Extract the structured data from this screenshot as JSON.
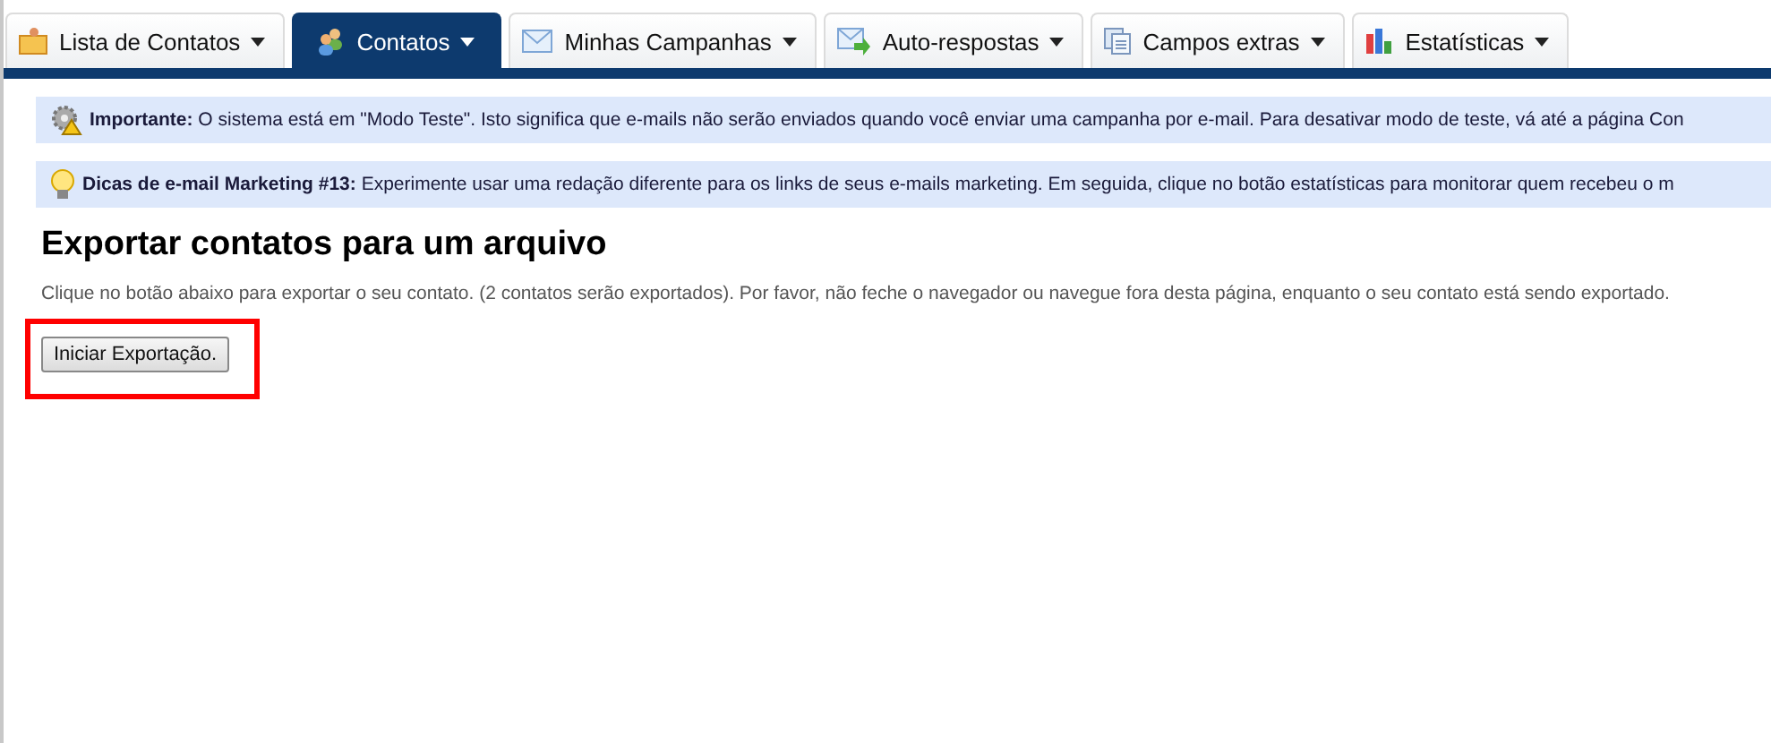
{
  "tabs": [
    {
      "label": "Lista de Contatos",
      "selected": false
    },
    {
      "label": "Contatos",
      "selected": true
    },
    {
      "label": "Minhas Campanhas",
      "selected": false
    },
    {
      "label": "Auto-respostas",
      "selected": false
    },
    {
      "label": "Campos extras",
      "selected": false
    },
    {
      "label": "Estatísticas",
      "selected": false
    }
  ],
  "notices": [
    {
      "kind": "important",
      "text": "**Importante:** O sistema está em \"Modo Teste\". Isto significa que e-mails não serão enviados quando você enviar uma campanha por e-mail. Para desativar modo de teste, vá até a página Con"
    },
    {
      "kind": "tip",
      "text": "**Dicas de e-mail Marketing #13:** Experimente usar uma redação diferente para os links de seus e-mails marketing. Em seguida, clique no botão estatísticas para monitorar quem recebeu o m"
    }
  ],
  "heading": "Exportar contatos para um arquivo",
  "description": "Clique no botão abaixo para exportar o seu contato. (2 contatos serão exportados). Por favor, não feche o navegador ou navegue fora desta página, enquanto o seu contato está sendo exportado.",
  "button": {
    "label": "Iniciar Exportação.",
    "highlighted": true
  }
}
